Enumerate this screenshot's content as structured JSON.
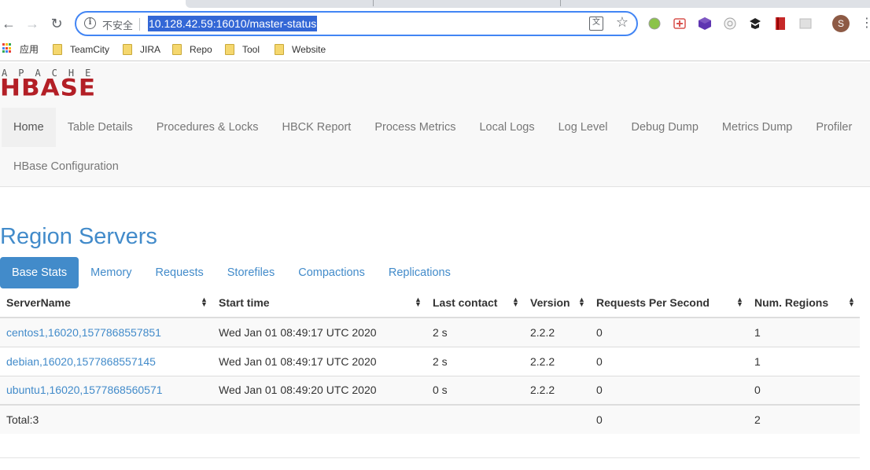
{
  "browser": {
    "security_label": "不安全",
    "url": "10.128.42.59:16010/master-status",
    "profile_initial": "S",
    "bookmarks": [
      {
        "label": "应用"
      },
      {
        "label": "TeamCity"
      },
      {
        "label": "JIRA"
      },
      {
        "label": "Repo"
      },
      {
        "label": "Tool"
      },
      {
        "label": "Website"
      }
    ]
  },
  "logo": {
    "top": "APACHE",
    "main": "HBASE"
  },
  "nav": {
    "items": [
      {
        "label": "Home"
      },
      {
        "label": "Table Details"
      },
      {
        "label": "Procedures & Locks"
      },
      {
        "label": "HBCK Report"
      },
      {
        "label": "Process Metrics"
      },
      {
        "label": "Local Logs"
      },
      {
        "label": "Log Level"
      },
      {
        "label": "Debug Dump"
      },
      {
        "label": "Metrics Dump"
      },
      {
        "label": "Profiler"
      },
      {
        "label": "HBase Configuration"
      }
    ]
  },
  "region_servers": {
    "title": "Region Servers",
    "tabs": [
      {
        "label": "Base Stats"
      },
      {
        "label": "Memory"
      },
      {
        "label": "Requests"
      },
      {
        "label": "Storefiles"
      },
      {
        "label": "Compactions"
      },
      {
        "label": "Replications"
      }
    ],
    "columns": [
      "ServerName",
      "Start time",
      "Last contact",
      "Version",
      "Requests Per Second",
      "Num. Regions"
    ],
    "rows": [
      {
        "server": "centos1,16020,1577868557851",
        "start": "Wed Jan 01 08:49:17 UTC 2020",
        "contact": "2 s",
        "version": "2.2.2",
        "rps": "0",
        "regions": "1"
      },
      {
        "server": "debian,16020,1577868557145",
        "start": "Wed Jan 01 08:49:17 UTC 2020",
        "contact": "2 s",
        "version": "2.2.2",
        "rps": "0",
        "regions": "1"
      },
      {
        "server": "ubuntu1,16020,1577868560571",
        "start": "Wed Jan 01 08:49:20 UTC 2020",
        "contact": "0 s",
        "version": "2.2.2",
        "rps": "0",
        "regions": "0"
      }
    ],
    "total": {
      "label": "Total:3",
      "rps": "0",
      "regions": "2"
    }
  },
  "colors": {
    "link": "#428bca",
    "logo_red": "#b31f26",
    "url_highlight": "#3367d6"
  }
}
